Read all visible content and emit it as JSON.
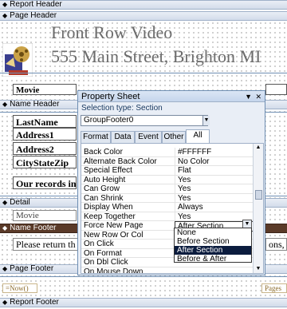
{
  "bands": {
    "report_header": "Report Header",
    "page_header": "Page Header",
    "name_header": "Name Header",
    "detail": "Detail",
    "name_footer": "Name Footer",
    "page_footer": "Page Footer",
    "report_footer": "Report Footer"
  },
  "page_header": {
    "title_line1": "Front Row Video",
    "title_line2": "555 Main Street, Brighton MI",
    "col_movie": "Movie"
  },
  "name_header": {
    "lastname": "LastName",
    "address1": "Address1",
    "address2": "Address2",
    "citystatezip": "CityStateZip",
    "records_text": "Our records in"
  },
  "detail": {
    "movie_field": "Movie"
  },
  "name_footer": {
    "return_text": "Please return th",
    "right_text": "ons, c"
  },
  "page_footer": {
    "left_text": "=Now()",
    "right_text": "Pages"
  },
  "property_sheet": {
    "title": "Property Sheet",
    "selection_label": "Selection type:",
    "selection_type": "Section",
    "object_combo": "GroupFooter0",
    "tabs": [
      "Format",
      "Data",
      "Event",
      "Other",
      "All"
    ],
    "active_tab": "All",
    "properties": [
      {
        "name": "Back Color",
        "value": "#FFFFFF"
      },
      {
        "name": "Alternate Back Color",
        "value": "No Color"
      },
      {
        "name": "Special Effect",
        "value": "Flat"
      },
      {
        "name": "Auto Height",
        "value": "Yes"
      },
      {
        "name": "Can Grow",
        "value": "Yes"
      },
      {
        "name": "Can Shrink",
        "value": "Yes"
      },
      {
        "name": "Display When",
        "value": "Always"
      },
      {
        "name": "Keep Together",
        "value": "Yes"
      },
      {
        "name": "Force New Page",
        "value": "After Section"
      },
      {
        "name": "New Row Or Col",
        "value": ""
      },
      {
        "name": "On Click",
        "value": ""
      },
      {
        "name": "On Format",
        "value": ""
      },
      {
        "name": "On Dbl Click",
        "value": ""
      },
      {
        "name": "On Mouse Down",
        "value": ""
      }
    ],
    "dropdown_options": [
      "None",
      "Before Section",
      "After Section",
      "Before & After"
    ],
    "dropdown_highlight": "After Section"
  }
}
